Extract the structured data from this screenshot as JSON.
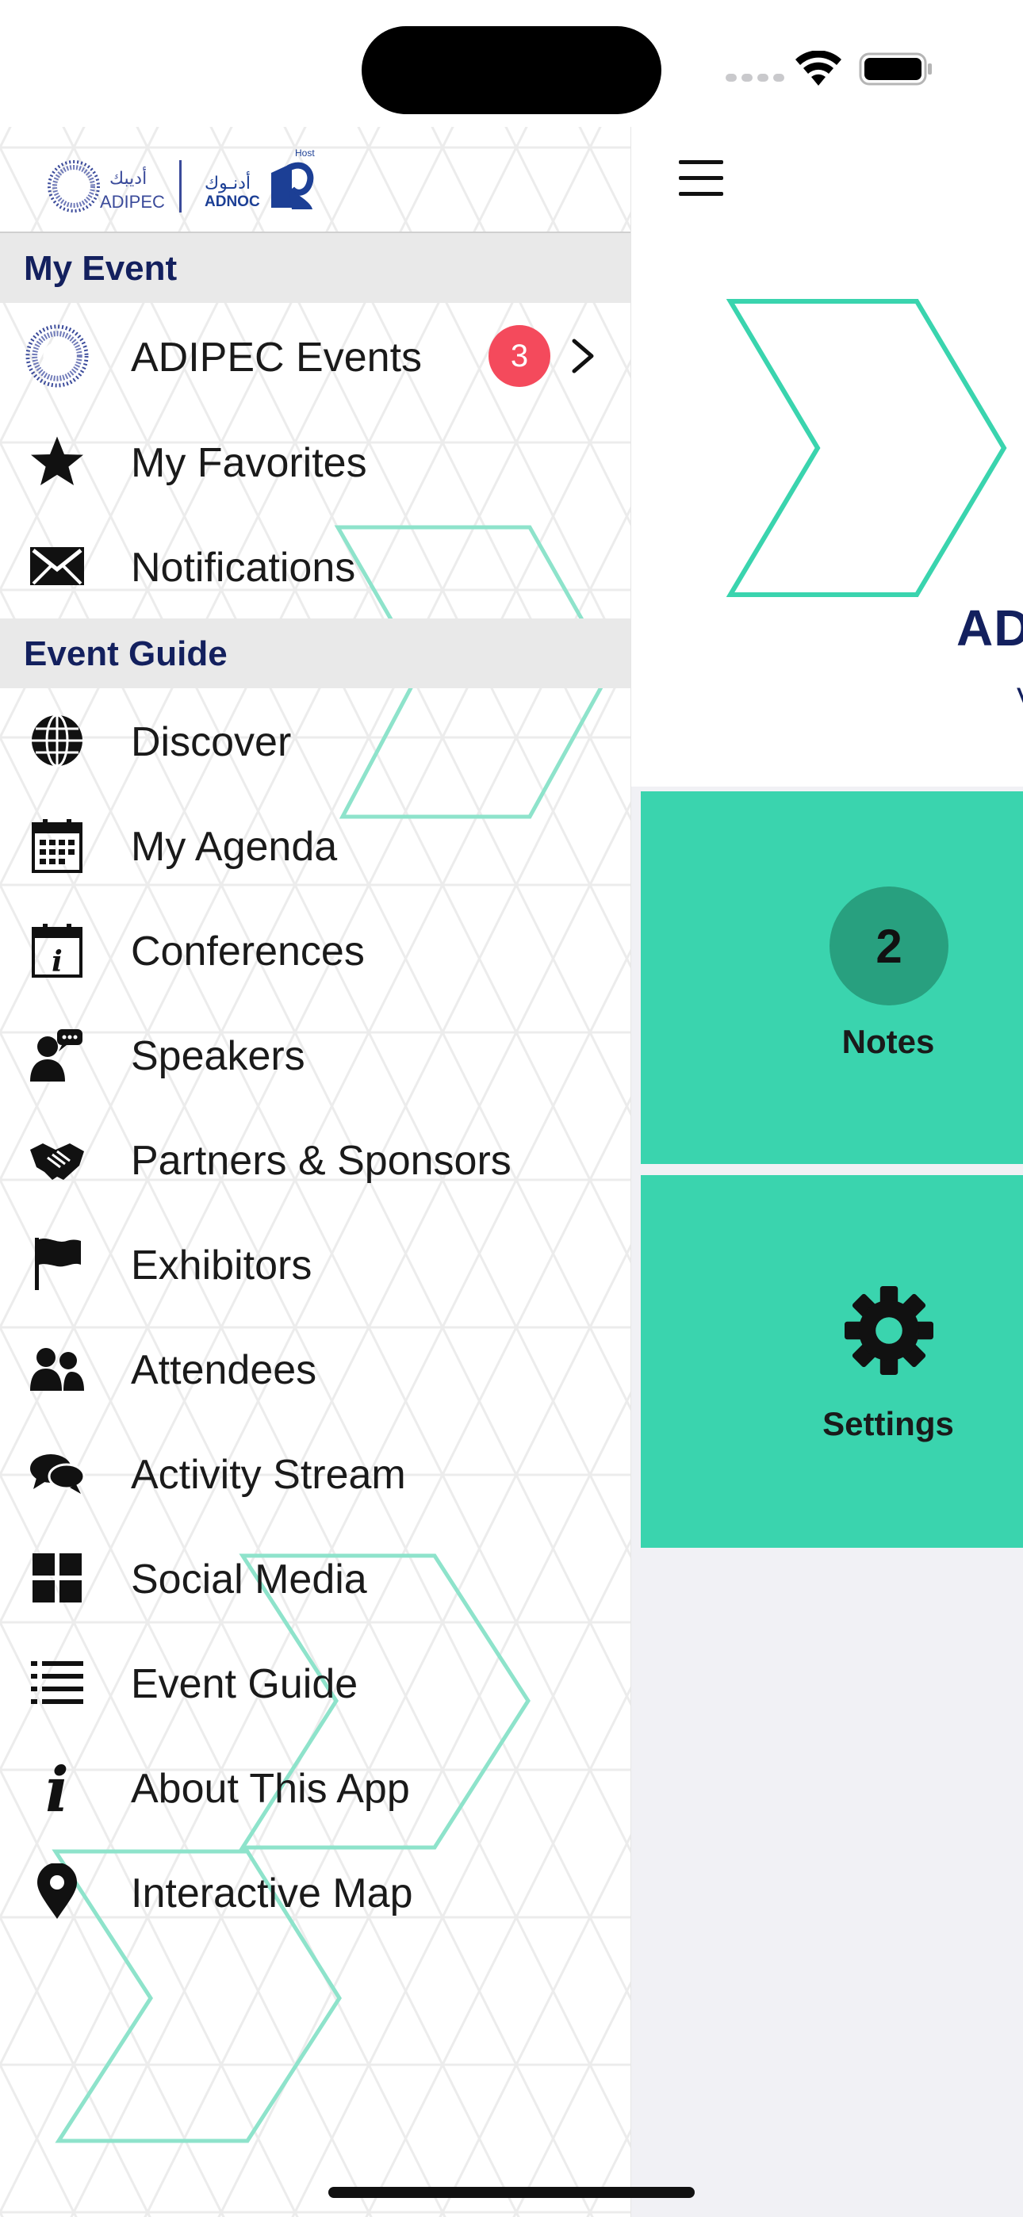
{
  "drawer": {
    "logos": {
      "adipec_arabic": "أديبك",
      "adipec_english": "ADIPEC",
      "adnoc_arabic": "أدنـوك",
      "adnoc_english": "ADNOC",
      "host_label": "Host"
    },
    "sections": [
      {
        "title": "My Event",
        "items": [
          {
            "label": "ADIPEC Events",
            "icon": "adipec-logo-icon",
            "badge": "3"
          },
          {
            "label": "My Favorites",
            "icon": "star-icon"
          },
          {
            "label": "Notifications",
            "icon": "envelope-icon"
          }
        ]
      },
      {
        "title": "Event Guide",
        "items": [
          {
            "label": "Discover",
            "icon": "globe-icon"
          },
          {
            "label": "My Agenda",
            "icon": "calendar-icon"
          },
          {
            "label": "Conferences",
            "icon": "calendar-info-icon"
          },
          {
            "label": "Speakers",
            "icon": "speaker-icon"
          },
          {
            "label": "Partners & Sponsors",
            "icon": "handshake-icon"
          },
          {
            "label": "Exhibitors",
            "icon": "flag-icon"
          },
          {
            "label": "Attendees",
            "icon": "attendees-icon"
          },
          {
            "label": "Activity Stream",
            "icon": "chat-bubbles-icon"
          },
          {
            "label": "Social Media",
            "icon": "grid-icon"
          },
          {
            "label": "Event Guide",
            "icon": "list-icon"
          },
          {
            "label": "About This App",
            "icon": "info-icon"
          },
          {
            "label": "Interactive Map",
            "icon": "map-pin-icon"
          }
        ]
      }
    ]
  },
  "main": {
    "title_partial": "AD",
    "subtitle_partial": "V",
    "tiles": [
      {
        "label": "Notes",
        "count": "2"
      },
      {
        "label": "Settings",
        "icon": "gear-icon"
      }
    ]
  },
  "colors": {
    "accent_teal": "#3ad4ae",
    "dark_teal": "#28a07f",
    "navy": "#13205e",
    "badge_red": "#f44a5c",
    "section_bg": "#e9e9e9"
  }
}
